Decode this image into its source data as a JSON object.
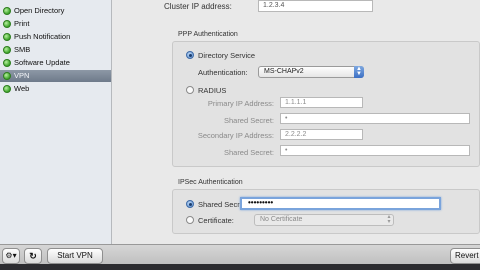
{
  "sidebar": {
    "items": [
      {
        "label": "Open Directory",
        "selected": false
      },
      {
        "label": "Print",
        "selected": false
      },
      {
        "label": "Push Notification",
        "selected": false
      },
      {
        "label": "SMB",
        "selected": false
      },
      {
        "label": "Software Update",
        "selected": false
      },
      {
        "label": "VPN",
        "selected": true
      },
      {
        "label": "Web",
        "selected": false
      }
    ],
    "status_color": "#3da52a"
  },
  "main": {
    "cluster_ip_label": "Cluster IP address:",
    "cluster_ip_value": "1.2.3.4",
    "ppp": {
      "title": "PPP Authentication",
      "directory_service": {
        "label": "Directory Service",
        "selected": true,
        "auth_label": "Authentication:",
        "auth_value": "MS-CHAPv2"
      },
      "radius": {
        "label": "RADIUS",
        "selected": false,
        "primary_ip_label": "Primary IP Address:",
        "primary_ip_value": "1.1.1.1",
        "shared_secret_label": "Shared Secret:",
        "shared_secret_value": "•",
        "secondary_ip_label": "Secondary IP Address:",
        "secondary_ip_value": "2.2.2.2",
        "shared_secret2_label": "Shared Secret:",
        "shared_secret2_value": "•"
      }
    },
    "ipsec": {
      "title": "IPSec Authentication",
      "shared_secret_label": "Shared Secret:",
      "shared_secret_value": "•••••••••",
      "shared_secret_selected": true,
      "certificate_label": "Certificate:",
      "certificate_value": "No Certificate",
      "certificate_selected": false
    }
  },
  "bottombar": {
    "start_label": "Start VPN",
    "revert_label": "Revert",
    "gear_icon": "gear-icon",
    "refresh_icon": "refresh-icon"
  },
  "colors": {
    "selection": "#7a8595",
    "focus_ring": "#7aa4dc"
  }
}
